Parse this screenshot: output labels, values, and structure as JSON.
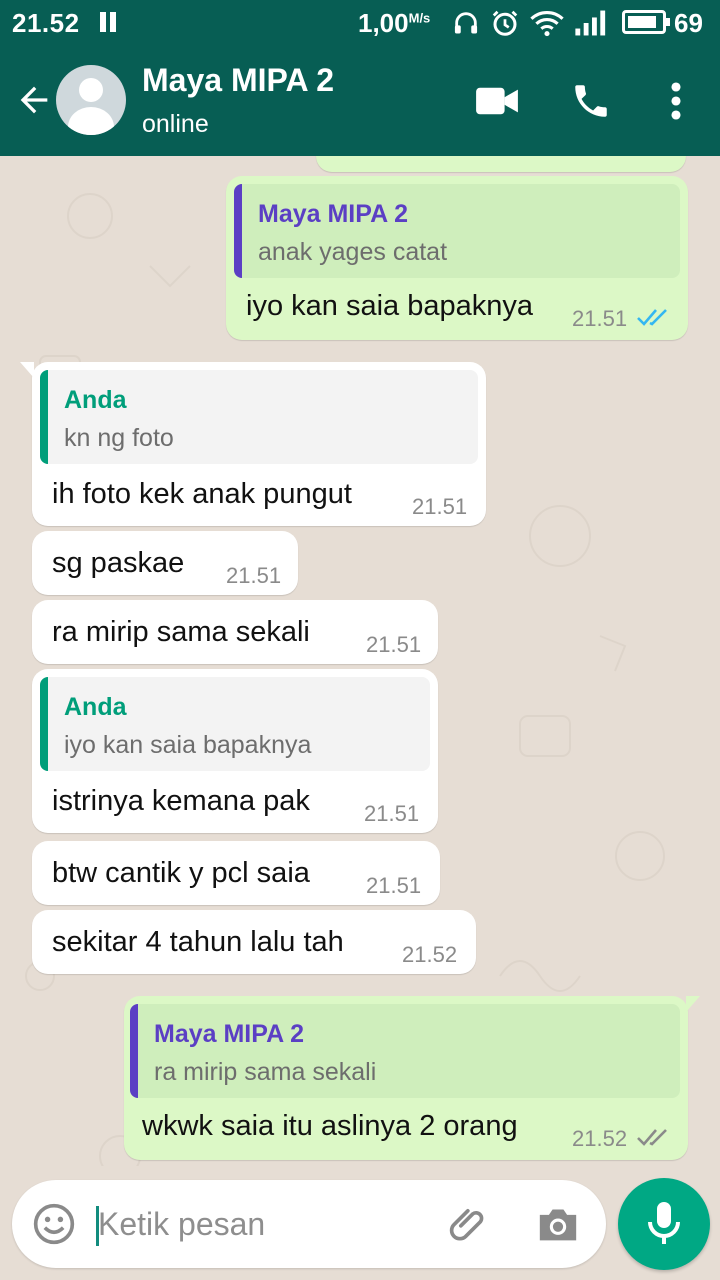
{
  "status_bar": {
    "time": "21.52",
    "network_speed": "1,00",
    "network_unit": "M/s",
    "battery_level": "69"
  },
  "header": {
    "contact_name": "Maya MIPA 2",
    "contact_status": "online"
  },
  "messages": [
    {
      "direction": "out",
      "quote_author": "Maya MIPA 2",
      "quote_text": "anak yages catat",
      "text": "iyo kan saia bapaknya",
      "time": "21.51",
      "ticks": "read"
    },
    {
      "direction": "in",
      "quote_author": "Anda",
      "quote_text": "kn ng foto",
      "text": "ih foto kek anak pungut",
      "time": "21.51"
    },
    {
      "direction": "in",
      "text": "sg paskae",
      "time": "21.51"
    },
    {
      "direction": "in",
      "text": "ra mirip sama sekali",
      "time": "21.51"
    },
    {
      "direction": "in",
      "quote_author": "Anda",
      "quote_text": "iyo kan saia bapaknya",
      "text": "istrinya kemana pak",
      "time": "21.51"
    },
    {
      "direction": "in",
      "text": "btw cantik y pcl saia",
      "time": "21.51"
    },
    {
      "direction": "in",
      "text": "sekitar 4 tahun lalu tah",
      "time": "21.52"
    },
    {
      "direction": "out",
      "quote_author": "Maya MIPA 2",
      "quote_text": "ra mirip sama sekali",
      "text": "wkwk saia itu aslinya 2 orang",
      "time": "21.52",
      "ticks": "delivered"
    }
  ],
  "composer": {
    "placeholder": "Ketik pesan"
  },
  "colors": {
    "header": "#075e54",
    "outgoing_bubble": "#dcf8c6",
    "incoming_bubble": "#ffffff",
    "quote_own_author": "#5b3fc4",
    "quote_you_author": "#009e7a",
    "read_ticks": "#34b7f1",
    "delivered_ticks": "#8a8a8a",
    "mic_button": "#00a884"
  }
}
